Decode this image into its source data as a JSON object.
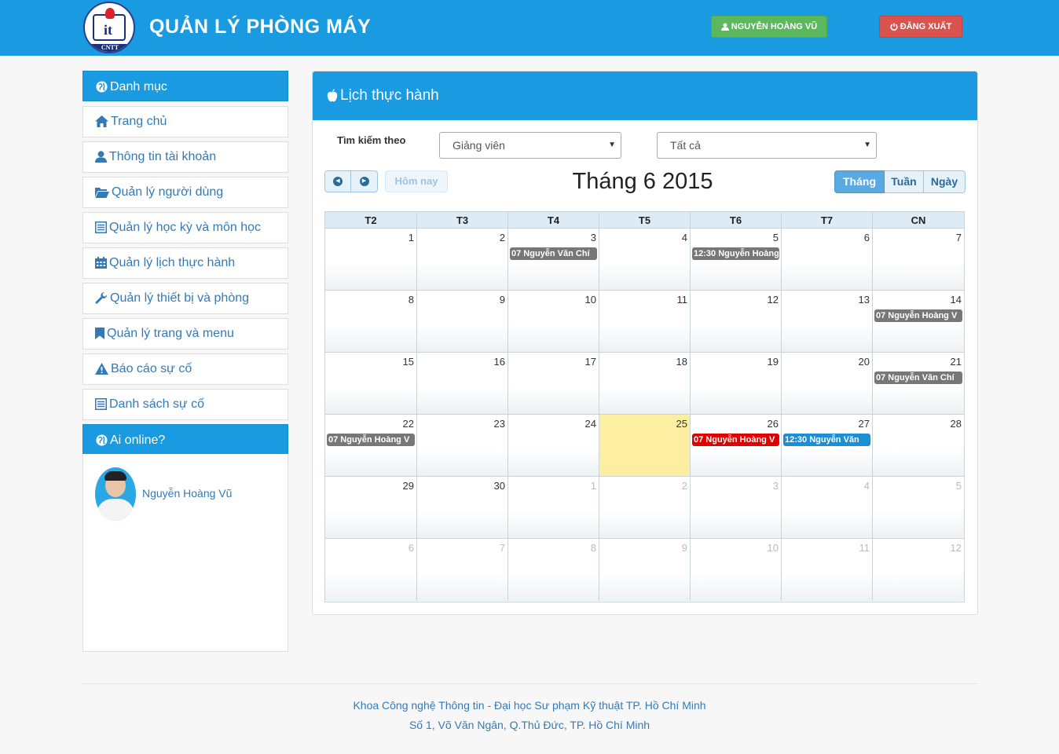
{
  "header": {
    "logo_label": "CNTT",
    "logo_mark": "it",
    "app_title": "QUẢN LÝ PHÒNG MÁY",
    "user_button": "NGUYỄN HOÀNG VŨ",
    "logout_button": "ĐĂNG XUẤT",
    "bg_color": "#1a9ae0"
  },
  "sidebar": {
    "title": "Danh mục",
    "items": [
      {
        "label": "Trang chủ",
        "icon": "home-icon"
      },
      {
        "label": "Thông tin tài khoản",
        "icon": "user-icon"
      },
      {
        "label": "Quản lý người dùng",
        "icon": "folder-open-icon"
      },
      {
        "label": "Quản lý học kỳ và môn học",
        "icon": "list-icon"
      },
      {
        "label": "Quản lý lịch thực hành",
        "icon": "calendar-icon"
      },
      {
        "label": "Quản lý thiết bị và phòng",
        "icon": "wrench-icon"
      },
      {
        "label": "Quản lý trang và menu",
        "icon": "bookmark-icon"
      },
      {
        "label": "Báo cáo sự cố",
        "icon": "warning-icon"
      },
      {
        "label": "Danh sách sự cố",
        "icon": "list-icon"
      }
    ],
    "online_title": "Ai online?",
    "online_user": "Nguyễn Hoàng Vũ"
  },
  "main": {
    "panel_title": "Lịch thực hành",
    "search_label": "Tìm kiếm theo",
    "filter_by": "Giảng viên",
    "filter_value": "Tất cả",
    "today_button": "Hôm nay",
    "calendar_title": "Tháng 6 2015",
    "views": [
      "Tháng",
      "Tuần",
      "Ngày"
    ],
    "active_view": "Tháng",
    "weekdays": [
      "T2",
      "T3",
      "T4",
      "T5",
      "T6",
      "T7",
      "CN"
    ],
    "weeks": [
      [
        {
          "d": "1"
        },
        {
          "d": "2"
        },
        {
          "d": "3",
          "event": "07 Nguyễn Văn Chí",
          "color": "#777777"
        },
        {
          "d": "4"
        },
        {
          "d": "5",
          "event": "12:30 Nguyễn Hoàng",
          "color": "#777777"
        },
        {
          "d": "6"
        },
        {
          "d": "7"
        }
      ],
      [
        {
          "d": "8"
        },
        {
          "d": "9"
        },
        {
          "d": "10"
        },
        {
          "d": "11"
        },
        {
          "d": "12"
        },
        {
          "d": "13"
        },
        {
          "d": "14",
          "event": "07 Nguyễn Hoàng V",
          "color": "#777777"
        }
      ],
      [
        {
          "d": "15"
        },
        {
          "d": "16"
        },
        {
          "d": "17"
        },
        {
          "d": "18"
        },
        {
          "d": "19"
        },
        {
          "d": "20"
        },
        {
          "d": "21",
          "event": "07 Nguyễn Văn Chí",
          "color": "#777777"
        }
      ],
      [
        {
          "d": "22",
          "event": "07 Nguyễn Hoàng V",
          "color": "#777777"
        },
        {
          "d": "23"
        },
        {
          "d": "24"
        },
        {
          "d": "25",
          "today": true
        },
        {
          "d": "26",
          "event": "07 Nguyễn Hoàng V",
          "color": "#e00000"
        },
        {
          "d": "27",
          "event": "12:30 Nguyễn Văn",
          "color": "#1a8fd6"
        },
        {
          "d": "28"
        }
      ],
      [
        {
          "d": "29"
        },
        {
          "d": "30"
        },
        {
          "d": "1",
          "other": true
        },
        {
          "d": "2",
          "other": true
        },
        {
          "d": "3",
          "other": true
        },
        {
          "d": "4",
          "other": true
        },
        {
          "d": "5",
          "other": true
        }
      ],
      [
        {
          "d": "6",
          "other": true
        },
        {
          "d": "7",
          "other": true
        },
        {
          "d": "8",
          "other": true
        },
        {
          "d": "9",
          "other": true
        },
        {
          "d": "10",
          "other": true
        },
        {
          "d": "11",
          "other": true
        },
        {
          "d": "12",
          "other": true
        }
      ]
    ]
  },
  "footer": {
    "line1": "Khoa Công nghệ Thông tin - Đại học Sư phạm Kỹ thuật TP. Hồ Chí Minh",
    "line2": "Số 1, Võ Văn Ngân, Q.Thủ Đức, TP. Hồ Chí Minh"
  }
}
